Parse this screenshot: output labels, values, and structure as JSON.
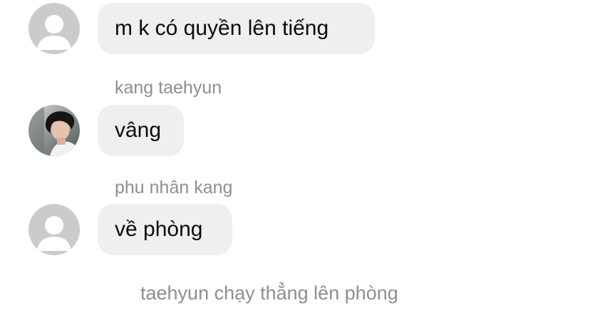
{
  "conversation": {
    "messages": [
      {
        "sender": "",
        "avatar": "default-avatar-icon",
        "text": "m k có quyền lên tiếng"
      },
      {
        "sender": "kang taehyun",
        "avatar": "profile-photo",
        "text": "vâng"
      },
      {
        "sender": "phu nhân kang",
        "avatar": "default-avatar-icon",
        "text": "về phòng"
      }
    ],
    "narration": "taehyun chạy thẳng lên phòng"
  },
  "colors": {
    "bubble_background": "#efeff0",
    "message_text": "#0b0b0b",
    "secondary_text": "#8e8e93",
    "default_avatar_background": "#cacbcd",
    "default_avatar_figure": "#ffffff"
  }
}
